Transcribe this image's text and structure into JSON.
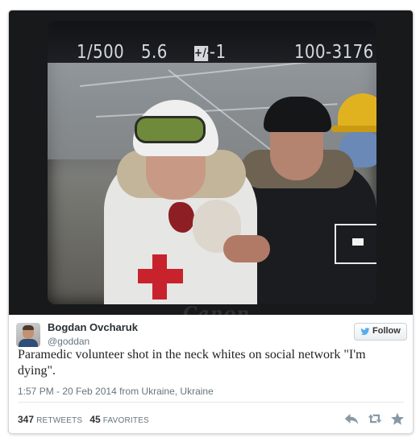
{
  "photo": {
    "shutter": "1/500",
    "aperture": "5.6",
    "exposure_icon": "+/-",
    "exposure": "-1",
    "file_counter": "100-3176",
    "card_icon": "1",
    "brand": "Canon"
  },
  "author": {
    "name": "Bogdan Ovcharuk",
    "handle": "@goddan",
    "avatar_icon": "user-avatar"
  },
  "follow_button": {
    "label": "Follow",
    "icon": "twitter-bird-icon",
    "icon_color": "#55acee"
  },
  "tweet": {
    "text": "Paramedic volunteer shot in the neck whites on social network \"I'm dying\".",
    "timestamp": "1:57 PM - 20 Feb 2014 from Ukraine, Ukraine"
  },
  "stats": {
    "retweets_count": "347",
    "retweets_label": "RETWEETS",
    "favorites_count": "45",
    "favorites_label": "FAVORITES"
  },
  "actions": [
    {
      "name": "reply",
      "icon": "reply-icon"
    },
    {
      "name": "retweet",
      "icon": "retweet-icon"
    },
    {
      "name": "favorite",
      "icon": "star-icon"
    }
  ],
  "colors": {
    "text": "#292f33",
    "muted": "#66757f",
    "icon_gray": "#8899a6",
    "red_cross": "#c8232c"
  }
}
